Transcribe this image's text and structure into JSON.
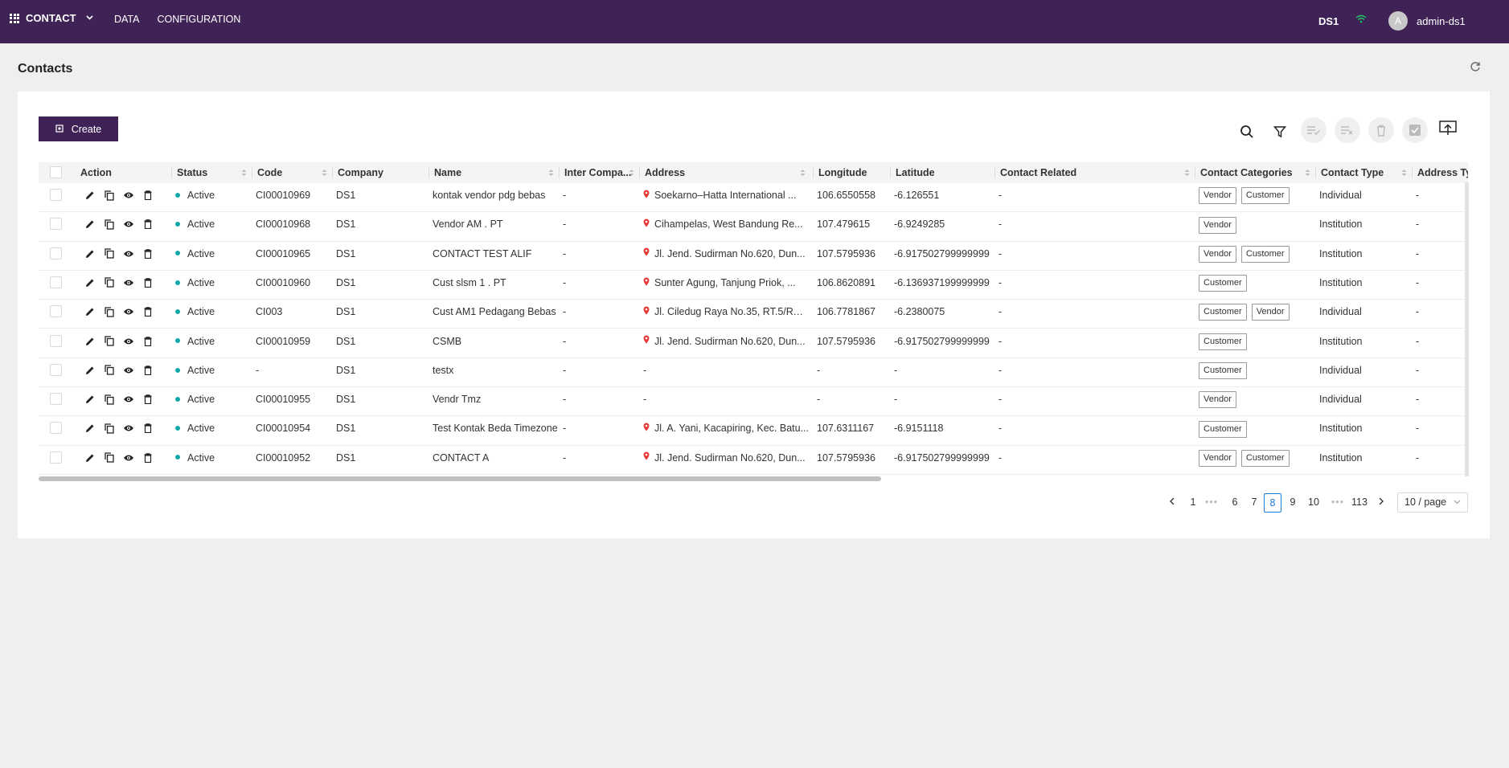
{
  "topbar": {
    "app_name": "CONTACT",
    "nav": [
      "DATA",
      "CONFIGURATION"
    ],
    "datasource": "DS1",
    "avatar_initial": "A",
    "username": "admin-ds1"
  },
  "page": {
    "title": "Contacts"
  },
  "toolbar": {
    "create_label": "Create"
  },
  "table": {
    "columns": [
      "Action",
      "Status",
      "Code",
      "Company",
      "Name",
      "Inter Compa...",
      "Address",
      "Longitude",
      "Latitude",
      "Contact Related",
      "Contact Categories",
      "Contact Type",
      "Address Ty"
    ],
    "rows": [
      {
        "status": "Active",
        "code": "CI00010969",
        "company": "DS1",
        "name": "kontak vendor pdg bebas",
        "inter": "-",
        "address": "Soekarno–Hatta International ...",
        "has_pin": true,
        "lon": "106.6550558",
        "lat": "-6.126551",
        "related": "-",
        "categories": [
          "Vendor",
          "Customer"
        ],
        "type": "Individual",
        "addr_type": "-"
      },
      {
        "status": "Active",
        "code": "CI00010968",
        "company": "DS1",
        "name": "Vendor AM . PT",
        "inter": "-",
        "address": "Cihampelas, West Bandung Re...",
        "has_pin": true,
        "lon": "107.479615",
        "lat": "-6.9249285",
        "related": "-",
        "categories": [
          "Vendor"
        ],
        "type": "Institution",
        "addr_type": "-"
      },
      {
        "status": "Active",
        "code": "CI00010965",
        "company": "DS1",
        "name": "CONTACT TEST ALIF",
        "inter": "-",
        "address": "Jl. Jend. Sudirman No.620, Dun...",
        "has_pin": true,
        "lon": "107.5795936",
        "lat": "-6.917502799999999",
        "related": "-",
        "categories": [
          "Vendor",
          "Customer"
        ],
        "type": "Institution",
        "addr_type": "-"
      },
      {
        "status": "Active",
        "code": "CI00010960",
        "company": "DS1",
        "name": "Cust slsm 1 . PT",
        "inter": "-",
        "address": "Sunter Agung, Tanjung Priok, ...",
        "has_pin": true,
        "lon": "106.8620891",
        "lat": "-6.136937199999999",
        "related": "-",
        "categories": [
          "Customer"
        ],
        "type": "Institution",
        "addr_type": "-"
      },
      {
        "status": "Active",
        "code": "CI003",
        "company": "DS1",
        "name": "Cust AM1 Pedagang Bebas",
        "inter": "-",
        "address": "Jl. Ciledug Raya No.35, RT.5/RW...",
        "has_pin": true,
        "lon": "106.7781867",
        "lat": "-6.2380075",
        "related": "-",
        "categories": [
          "Customer",
          "Vendor"
        ],
        "type": "Individual",
        "addr_type": "-"
      },
      {
        "status": "Active",
        "code": "CI00010959",
        "company": "DS1",
        "name": "CSMB",
        "inter": "-",
        "address": "Jl. Jend. Sudirman No.620, Dun...",
        "has_pin": true,
        "lon": "107.5795936",
        "lat": "-6.917502799999999",
        "related": "-",
        "categories": [
          "Customer"
        ],
        "type": "Institution",
        "addr_type": "-"
      },
      {
        "status": "Active",
        "code": "-",
        "company": "DS1",
        "name": "testx",
        "inter": "-",
        "address": "-",
        "has_pin": false,
        "lon": "-",
        "lat": "-",
        "related": "-",
        "categories": [
          "Customer"
        ],
        "type": "Individual",
        "addr_type": "-"
      },
      {
        "status": "Active",
        "code": "CI00010955",
        "company": "DS1",
        "name": "Vendr Tmz",
        "inter": "-",
        "address": "-",
        "has_pin": false,
        "lon": "-",
        "lat": "-",
        "related": "-",
        "categories": [
          "Vendor"
        ],
        "type": "Individual",
        "addr_type": "-"
      },
      {
        "status": "Active",
        "code": "CI00010954",
        "company": "DS1",
        "name": "Test Kontak Beda Timezone",
        "inter": "-",
        "address": "Jl. A. Yani, Kacapiring, Kec. Batu...",
        "has_pin": true,
        "lon": "107.6311167",
        "lat": "-6.9151118",
        "related": "-",
        "categories": [
          "Customer"
        ],
        "type": "Institution",
        "addr_type": "-"
      },
      {
        "status": "Active",
        "code": "CI00010952",
        "company": "DS1",
        "name": "CONTACT A",
        "inter": "-",
        "address": "Jl. Jend. Sudirman No.620, Dun...",
        "has_pin": true,
        "lon": "107.5795936",
        "lat": "-6.917502799999999",
        "related": "-",
        "categories": [
          "Vendor",
          "Customer"
        ],
        "type": "Institution",
        "addr_type": "-"
      }
    ]
  },
  "pagination": {
    "pages": [
      "1",
      "•••",
      "6",
      "7",
      "8",
      "9",
      "10",
      "•••",
      "113"
    ],
    "current": "8",
    "page_size": "10 / page"
  },
  "colors": {
    "brand": "#3f2356",
    "status_active": "#13a8a8",
    "pin": "#e53935",
    "wifi": "#22c55e"
  }
}
